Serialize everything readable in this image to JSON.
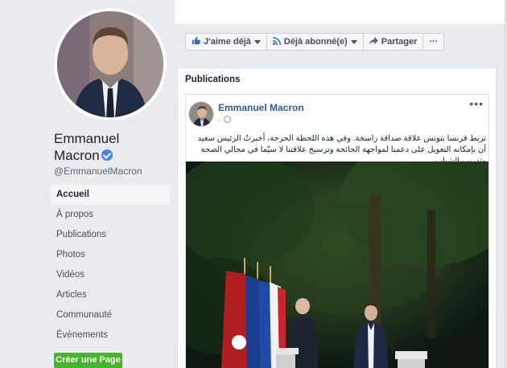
{
  "profile": {
    "name": "Emmanuel Macron",
    "handle": "@EmmanuelMacron",
    "verified_icon": "verified-badge-icon"
  },
  "nav": {
    "items": [
      {
        "label": "Accueil",
        "active": true
      },
      {
        "label": "À propos"
      },
      {
        "label": "Publications"
      },
      {
        "label": "Photos"
      },
      {
        "label": "Vidéos"
      },
      {
        "label": "Articles"
      },
      {
        "label": "Communauté"
      },
      {
        "label": "Évènements"
      }
    ],
    "create_page_label": "Créer une Page"
  },
  "actions": {
    "like_label": "J'aime déjà",
    "subscribed_label": "Déjà abonné(e)",
    "share_label": "Partager",
    "more_label": "···"
  },
  "publications": {
    "title": "Publications",
    "post": {
      "author": "Emmanuel Macron",
      "meta": "·",
      "more": "•••",
      "text": "تربط فرنسا بتونس علاقة صداقة راسخة. وفي هذه اللحظة الحرجة، أخبرتُ الرئيس سعيد أن بإمكانه التعويل على دعمنا لمواجهة الجائحة وترسيخ علاقتنا لا سيّما في مجالي الصحة وتدريب الشباب."
    }
  },
  "colors": {
    "accent": "#4267b2",
    "link": "#365899",
    "green_button": "#42b72a",
    "verified": "#4080ff"
  }
}
